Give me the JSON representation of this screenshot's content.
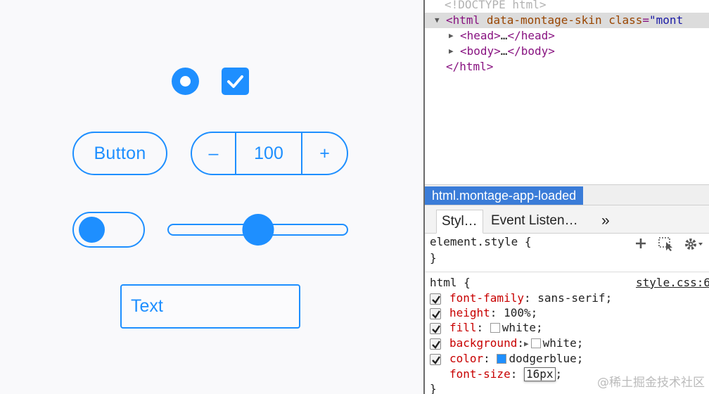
{
  "demo": {
    "button_label": "Button",
    "stepper": {
      "minus": "–",
      "value": "100",
      "plus": "+"
    },
    "slider_value_fraction": 0.5,
    "text_field_value": "Text"
  },
  "devtools": {
    "dom": {
      "doctype": "<!DOCTYPE html>",
      "html_open_tag": "<html",
      "html_attr1": "data-montage-skin",
      "html_attr2": "class",
      "html_attr2_value": "\"mont",
      "head": "<head>",
      "head_ellipsis": "…",
      "head_close": "</head>",
      "body": "<body>",
      "body_ellipsis": "…",
      "body_close": "</body>",
      "html_close": "</html>"
    },
    "breadcrumb": "html.montage-app-loaded",
    "tabs": [
      "Styl…",
      "Event Listen…",
      "»"
    ],
    "element_style_selector": "element.style {",
    "element_style_close": "}",
    "rule": {
      "selector": "html {",
      "source": "style.css:6",
      "properties": [
        {
          "name": "font-family",
          "value": "sans-serif;"
        },
        {
          "name": "height",
          "value": "100%;"
        },
        {
          "name": "fill",
          "value": "white;",
          "swatch": "#ffffff"
        },
        {
          "name": "background",
          "value": "white;",
          "swatch": "#ffffff"
        },
        {
          "name": "color",
          "value": "dodgerblue;",
          "swatch": "#1e8fff"
        },
        {
          "name": "font-size",
          "value": "16px"
        }
      ],
      "close": "}"
    },
    "watermark": "@稀土掘金技术社区"
  },
  "colors": {
    "accent": "#1e8fff",
    "selection": "#3a7cd8"
  },
  "icons": [
    "radio-checked-icon",
    "checkmark-icon",
    "plus-icon",
    "element-picker-icon",
    "gear-icon",
    "disclosure-triangle-icon"
  ]
}
